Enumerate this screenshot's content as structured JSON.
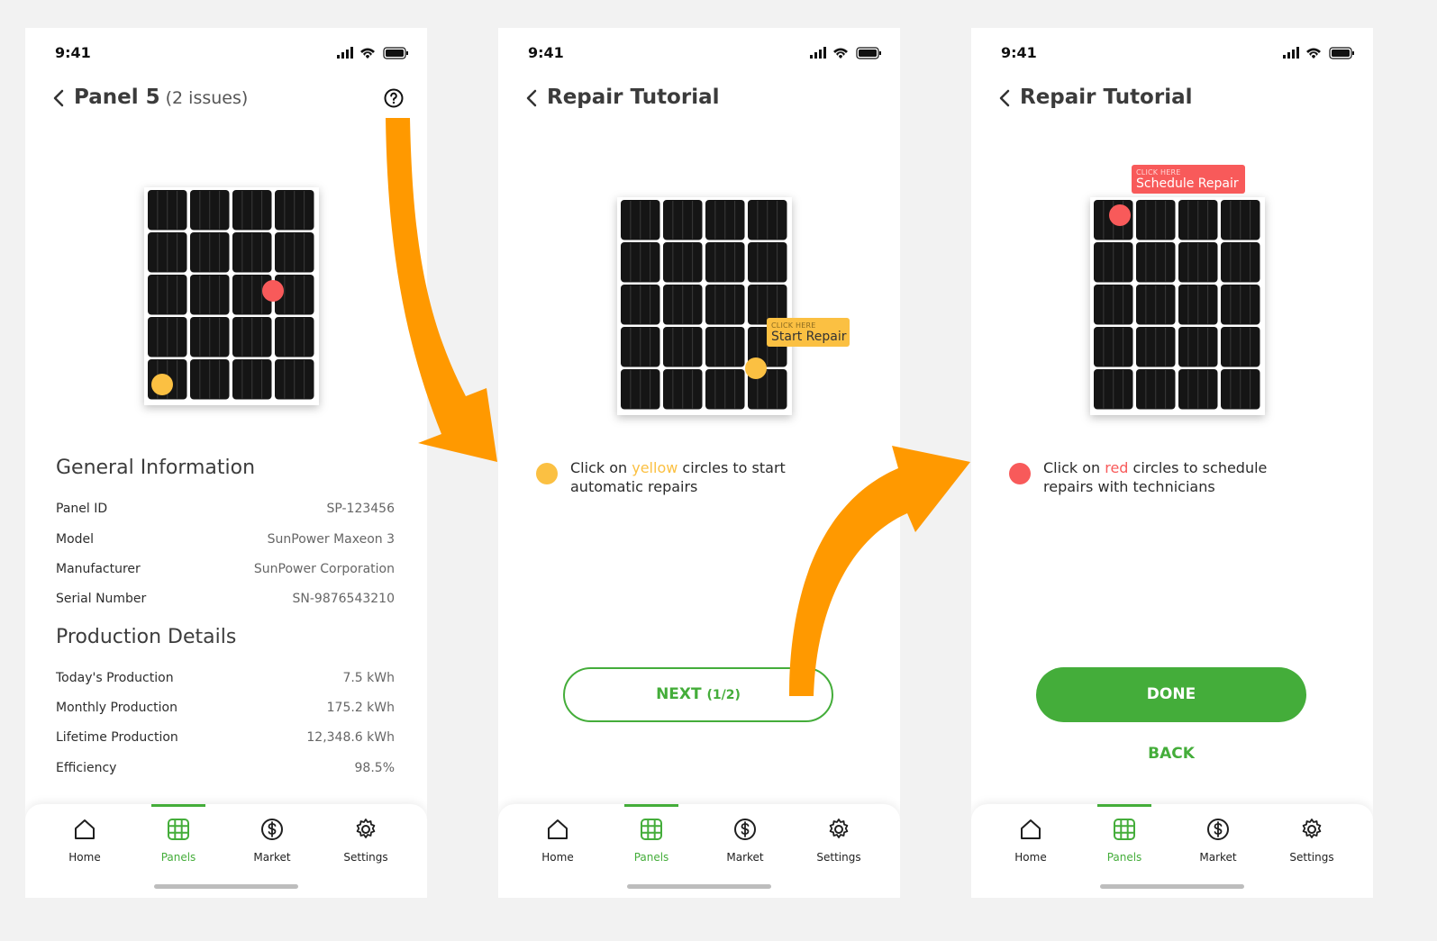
{
  "status": {
    "time": "9:41"
  },
  "screen1": {
    "title": "Panel 5",
    "issues": "(2 issues)",
    "general_title": "General Information",
    "general": [
      {
        "label": "Panel ID",
        "value": "SP-123456"
      },
      {
        "label": "Model",
        "value": "SunPower Maxeon 3"
      },
      {
        "label": "Manufacturer",
        "value": "SunPower Corporation"
      },
      {
        "label": "Serial Number",
        "value": "SN-9876543210"
      }
    ],
    "production_title": "Production Details",
    "production": [
      {
        "label": "Today's Production",
        "value": "7.5 kWh"
      },
      {
        "label": "Monthly Production",
        "value": "175.2 kWh"
      },
      {
        "label": "Lifetime Production",
        "value": "12,348.6 kWh"
      },
      {
        "label": "Efficiency",
        "value": "98.5%"
      }
    ]
  },
  "screen2": {
    "title": "Repair Tutorial",
    "tooltip_small": "CLICK HERE",
    "tooltip_big": "Start Repair",
    "legend_pre": "Click on ",
    "legend_highlight": "yellow",
    "legend_post": " circles to start automatic repairs",
    "next_label": "NEXT",
    "next_count": "(1/2)"
  },
  "screen3": {
    "title": "Repair Tutorial",
    "tooltip_small": "CLICK HERE",
    "tooltip_big": "Schedule Repair",
    "legend_pre": "Click on ",
    "legend_highlight": "red",
    "legend_post": " circles to schedule repairs with technicians",
    "done_label": "DONE",
    "back_label": "BACK"
  },
  "nav": [
    {
      "label": "Home",
      "icon": "home-icon"
    },
    {
      "label": "Panels",
      "icon": "grid-icon",
      "active": true
    },
    {
      "label": "Market",
      "icon": "dollar-icon"
    },
    {
      "label": "Settings",
      "icon": "gear-icon"
    }
  ],
  "colors": {
    "accent": "#44ad3a",
    "arrow": "#ff9900",
    "issue_red": "#f85a5a",
    "issue_yellow": "#fbc042"
  }
}
